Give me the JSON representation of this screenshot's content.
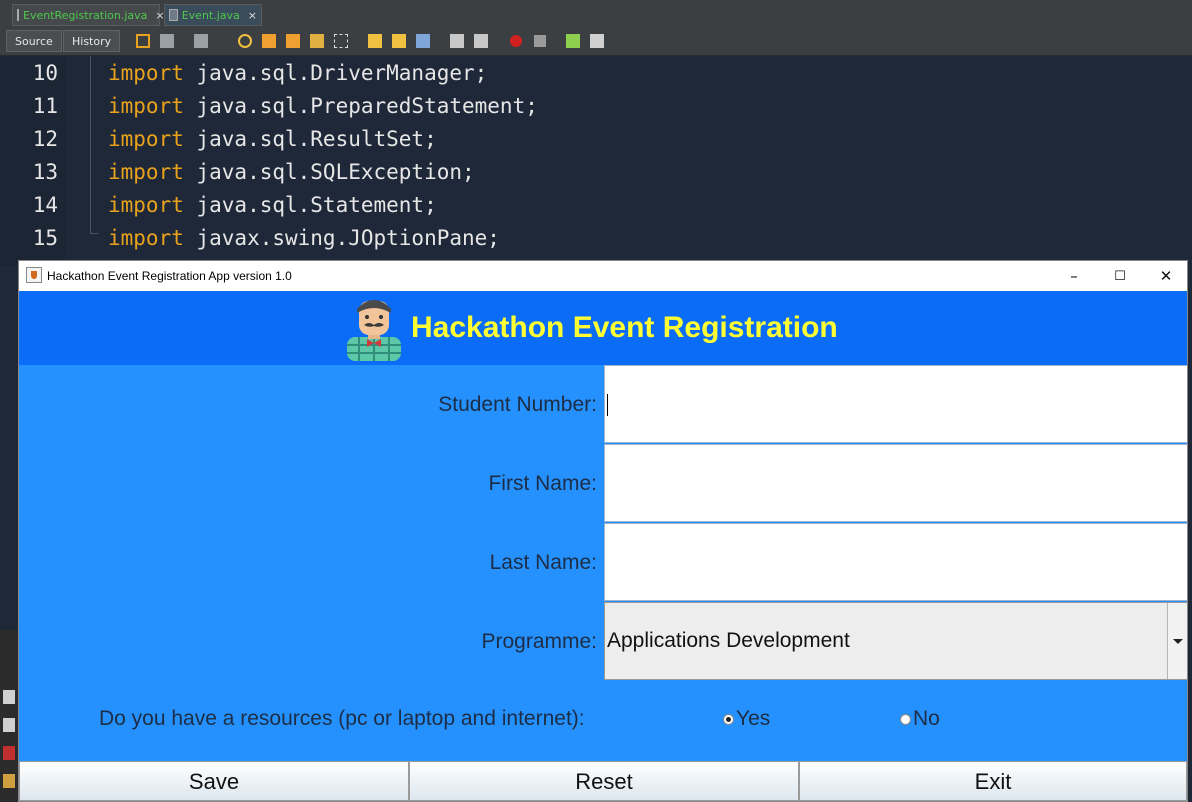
{
  "ide": {
    "tabs": [
      {
        "label": "EventRegistration.java",
        "close": "×"
      },
      {
        "label": "Event.java",
        "close": "×"
      }
    ],
    "toolbar": {
      "source": "Source",
      "history": "History"
    },
    "code": [
      {
        "line": "10",
        "kw": "import",
        "rest": " java.sql.DriverManager;"
      },
      {
        "line": "11",
        "kw": "import",
        "rest": " java.sql.PreparedStatement;"
      },
      {
        "line": "12",
        "kw": "import",
        "rest": " java.sql.ResultSet;"
      },
      {
        "line": "13",
        "kw": "import",
        "rest": " java.sql.SQLException;"
      },
      {
        "line": "14",
        "kw": "import",
        "rest": " java.sql.Statement;"
      },
      {
        "line": "15",
        "kw": "import",
        "rest": " javax.swing.JOptionPane;"
      }
    ]
  },
  "window": {
    "title": "Hackathon Event Registration App version 1.0",
    "minimize": "–",
    "maximize": "☐",
    "close": "✕"
  },
  "header": {
    "title": "Hackathon Event Registration"
  },
  "form": {
    "student_number": {
      "label": "Student Number:",
      "value": ""
    },
    "first_name": {
      "label": "First Name:",
      "value": ""
    },
    "last_name": {
      "label": "Last Name:",
      "value": ""
    },
    "programme": {
      "label": "Programme:",
      "value": "Applications Development"
    },
    "resources": {
      "question": "Do you have a resources (pc or laptop and internet):",
      "yes": "Yes",
      "no": "No",
      "selected": "Yes"
    }
  },
  "actions": {
    "save": "Save",
    "reset": "Reset",
    "exit": "Exit"
  },
  "colors": {
    "header_bg": "#0b6cf7",
    "form_bg": "#2591ff",
    "title_yellow": "#ffff33",
    "keyword": "#e8a21c"
  }
}
